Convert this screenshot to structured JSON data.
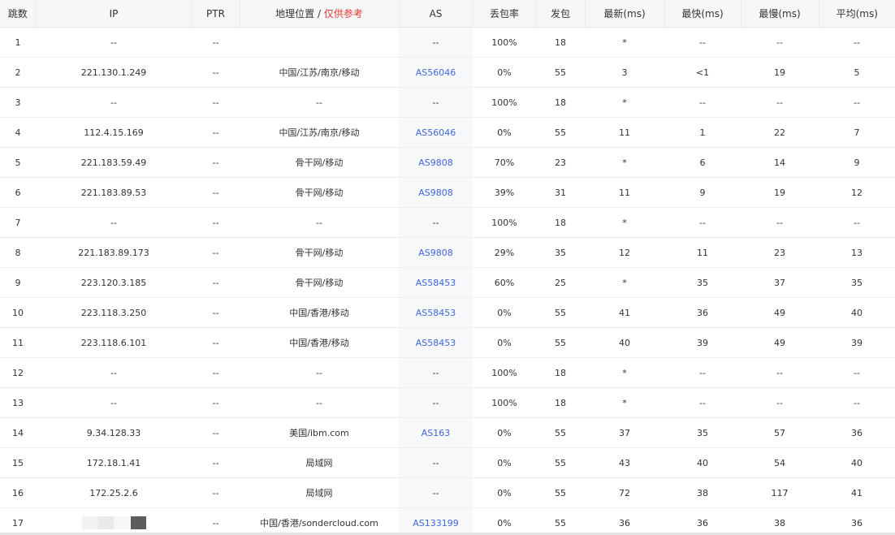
{
  "headers": {
    "hop": "跳数",
    "ip": "IP",
    "ptr": "PTR",
    "geo": "地理位置",
    "geo_sep": " / ",
    "geo_note": "仅供参考",
    "as": "AS",
    "loss": "丢包率",
    "sent": "发包",
    "last": "最新(ms)",
    "best": "最快(ms)",
    "worst": "最慢(ms)",
    "avg": "平均(ms)"
  },
  "accent_colors": {
    "as_link": "#3f66e0",
    "note": "#e53935"
  },
  "rows": [
    {
      "hop": "1",
      "ip": "--",
      "ptr": "--",
      "geo": "",
      "as": "--",
      "loss": "100%",
      "sent": "18",
      "last": "*",
      "best": "--",
      "worst": "--",
      "avg": "--"
    },
    {
      "hop": "2",
      "ip": "221.130.1.249",
      "ptr": "--",
      "geo": "中国/江苏/南京/移动",
      "as": "AS56046",
      "loss": "0%",
      "sent": "55",
      "last": "3",
      "best": "<1",
      "worst": "19",
      "avg": "5"
    },
    {
      "hop": "3",
      "ip": "--",
      "ptr": "--",
      "geo": "--",
      "as": "--",
      "loss": "100%",
      "sent": "18",
      "last": "*",
      "best": "--",
      "worst": "--",
      "avg": "--"
    },
    {
      "hop": "4",
      "ip": "112.4.15.169",
      "ptr": "--",
      "geo": "中国/江苏/南京/移动",
      "as": "AS56046",
      "loss": "0%",
      "sent": "55",
      "last": "11",
      "best": "1",
      "worst": "22",
      "avg": "7"
    },
    {
      "hop": "5",
      "ip": "221.183.59.49",
      "ptr": "--",
      "geo": "骨干网/移动",
      "as": "AS9808",
      "loss": "70%",
      "sent": "23",
      "last": "*",
      "best": "6",
      "worst": "14",
      "avg": "9"
    },
    {
      "hop": "6",
      "ip": "221.183.89.53",
      "ptr": "--",
      "geo": "骨干网/移动",
      "as": "AS9808",
      "loss": "39%",
      "sent": "31",
      "last": "11",
      "best": "9",
      "worst": "19",
      "avg": "12"
    },
    {
      "hop": "7",
      "ip": "--",
      "ptr": "--",
      "geo": "--",
      "as": "--",
      "loss": "100%",
      "sent": "18",
      "last": "*",
      "best": "--",
      "worst": "--",
      "avg": "--"
    },
    {
      "hop": "8",
      "ip": "221.183.89.173",
      "ptr": "--",
      "geo": "骨干网/移动",
      "as": "AS9808",
      "loss": "29%",
      "sent": "35",
      "last": "12",
      "best": "11",
      "worst": "23",
      "avg": "13"
    },
    {
      "hop": "9",
      "ip": "223.120.3.185",
      "ptr": "--",
      "geo": "骨干网/移动",
      "as": "AS58453",
      "loss": "60%",
      "sent": "25",
      "last": "*",
      "best": "35",
      "worst": "37",
      "avg": "35"
    },
    {
      "hop": "10",
      "ip": "223.118.3.250",
      "ptr": "--",
      "geo": "中国/香港/移动",
      "as": "AS58453",
      "loss": "0%",
      "sent": "55",
      "last": "41",
      "best": "36",
      "worst": "49",
      "avg": "40"
    },
    {
      "hop": "11",
      "ip": "223.118.6.101",
      "ptr": "--",
      "geo": "中国/香港/移动",
      "as": "AS58453",
      "loss": "0%",
      "sent": "55",
      "last": "40",
      "best": "39",
      "worst": "49",
      "avg": "39"
    },
    {
      "hop": "12",
      "ip": "--",
      "ptr": "--",
      "geo": "--",
      "as": "--",
      "loss": "100%",
      "sent": "18",
      "last": "*",
      "best": "--",
      "worst": "--",
      "avg": "--"
    },
    {
      "hop": "13",
      "ip": "--",
      "ptr": "--",
      "geo": "--",
      "as": "--",
      "loss": "100%",
      "sent": "18",
      "last": "*",
      "best": "--",
      "worst": "--",
      "avg": "--"
    },
    {
      "hop": "14",
      "ip": "9.34.128.33",
      "ptr": "--",
      "geo": "美国/ibm.com",
      "as": "AS163",
      "loss": "0%",
      "sent": "55",
      "last": "37",
      "best": "35",
      "worst": "57",
      "avg": "36"
    },
    {
      "hop": "15",
      "ip": "172.18.1.41",
      "ptr": "--",
      "geo": "局域网",
      "as": "--",
      "loss": "0%",
      "sent": "55",
      "last": "43",
      "best": "40",
      "worst": "54",
      "avg": "40"
    },
    {
      "hop": "16",
      "ip": "172.25.2.6",
      "ptr": "--",
      "geo": "局域网",
      "as": "--",
      "loss": "0%",
      "sent": "55",
      "last": "72",
      "best": "38",
      "worst": "117",
      "avg": "41"
    },
    {
      "hop": "17",
      "ip": "",
      "ip_masked": true,
      "ptr": "--",
      "geo": "中国/香港/sondercloud.com",
      "as": "AS133199",
      "loss": "0%",
      "sent": "55",
      "last": "36",
      "best": "36",
      "worst": "38",
      "avg": "36"
    }
  ]
}
